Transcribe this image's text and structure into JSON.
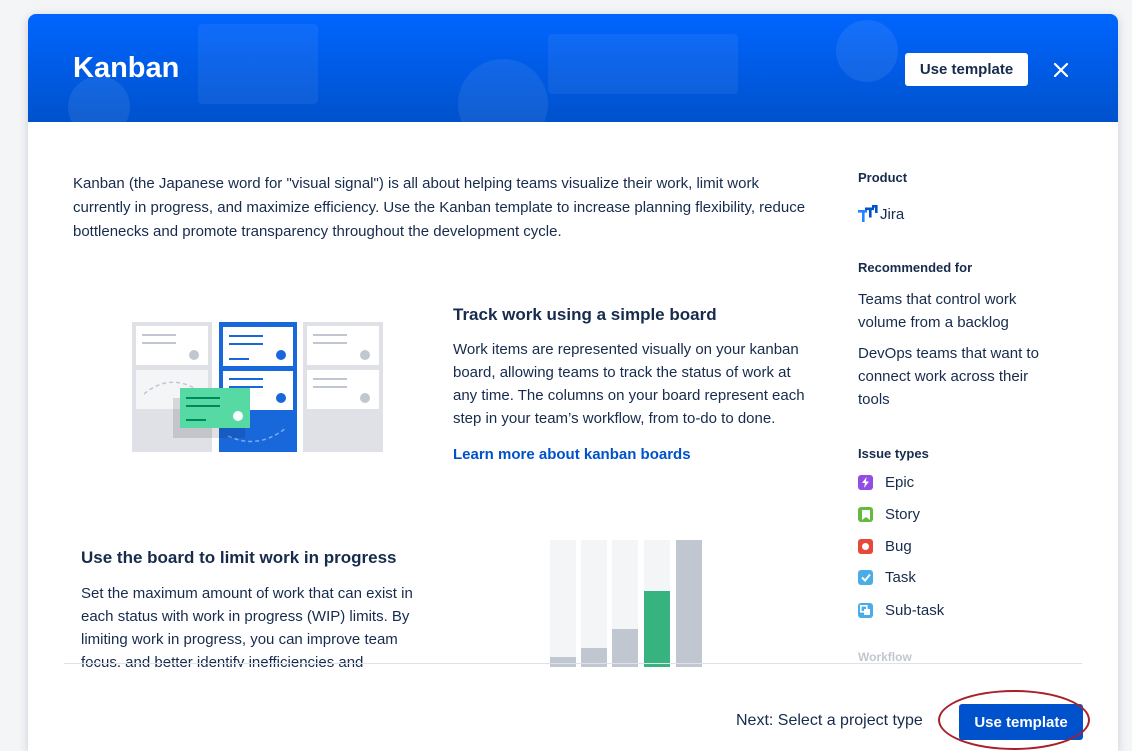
{
  "modal": {
    "title": "Kanban",
    "header_button": "Use template",
    "close_icon": "close-icon"
  },
  "intro": "Kanban (the Japanese word for \"visual signal\") is all about helping teams visualize their work, limit work currently in progress, and maximize efficiency. Use the Kanban template to increase planning flexibility, reduce bottlenecks and promote transparency throughout the development cycle.",
  "sections": [
    {
      "title": "Track work using a simple board",
      "body": "Work items are represented visually on your kanban board, allowing teams to track the status of work at any time. The columns on your board represent each step in your team’s workflow, from to-do to done.",
      "link": "Learn more about kanban boards"
    },
    {
      "title": "Use the board to limit work in progress",
      "body": "Set the maximum amount of work that can exist in each status with work in progress (WIP) limits. By limiting work in progress, you can improve team focus, and better identify inefficiencies and bottlenecks."
    }
  ],
  "sidebar": {
    "product_label": "Product",
    "product_name": "Jira",
    "product_icon": "jira-logo-icon",
    "recommended_label": "Recommended for",
    "recommended": [
      "Teams that control work volume from a backlog",
      "DevOps teams that want to connect work across their tools"
    ],
    "issue_types_label": "Issue types",
    "issue_types": [
      {
        "name": "Epic",
        "icon": "epic-icon",
        "color": "#904ee2"
      },
      {
        "name": "Story",
        "icon": "story-icon",
        "color": "#63ba3c"
      },
      {
        "name": "Bug",
        "icon": "bug-icon",
        "color": "#e5493a"
      },
      {
        "name": "Task",
        "icon": "task-icon",
        "color": "#4bade8"
      },
      {
        "name": "Sub-task",
        "icon": "subtask-icon",
        "color": "#4bade8"
      }
    ],
    "workflow_label": "Workflow"
  },
  "footer": {
    "next_text": "Next: Select a project type",
    "primary_button": "Use template"
  },
  "colors": {
    "header_blue": "#0052cc",
    "link_blue": "#0052cc",
    "annotation_red": "#a8202a"
  }
}
